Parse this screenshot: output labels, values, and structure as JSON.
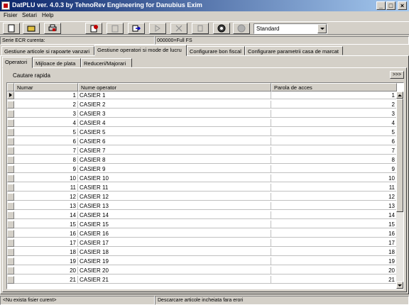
{
  "window": {
    "title": "DatPLU ver. 4.0.3 by TehnoRev Engineering for Danubius Exim",
    "minimize": "_",
    "maximize": "□",
    "close": "×"
  },
  "menu": [
    "Fisier",
    "Setari",
    "Help"
  ],
  "toolbar": {
    "buttons": [
      "new-file-icon",
      "open-folder-icon",
      "print-icon",
      "add-record-icon",
      "disabled-add-icon",
      "send-arrow-icon",
      "disabled-send-icon",
      "delete-icon",
      "disabled-icon",
      "disk-icon",
      "disabled-circle-icon"
    ],
    "profile_value": "Standard"
  },
  "status_top": {
    "serie_label": "Serie ECR curenta:",
    "serie_value": "000000=Full FS"
  },
  "tabs_main": [
    "Gestiune articole si rapoarte vanzari",
    "Gestiune operatori si mode de lucru",
    "Configurare bon fiscal",
    "Configurare parametrii casa de marcat"
  ],
  "tabs_sub": [
    "Operatori",
    "Mijloace de plata",
    "Reduceri/Majorari"
  ],
  "quick_search": {
    "label": "Cautare rapida",
    "button": ">>>"
  },
  "grid": {
    "columns": [
      "Numar",
      "Nume operator",
      "Parola de acces"
    ],
    "rows": [
      [
        "1",
        "CASIER  1",
        "1"
      ],
      [
        "2",
        "CASIER  2",
        "2"
      ],
      [
        "3",
        "CASIER  3",
        "3"
      ],
      [
        "4",
        "CASIER  4",
        "4"
      ],
      [
        "5",
        "CASIER  5",
        "5"
      ],
      [
        "6",
        "CASIER  6",
        "6"
      ],
      [
        "7",
        "CASIER  7",
        "7"
      ],
      [
        "8",
        "CASIER  8",
        "8"
      ],
      [
        "9",
        "CASIER  9",
        "9"
      ],
      [
        "10",
        "CASIER  10",
        "10"
      ],
      [
        "11",
        "CASIER  11",
        "11"
      ],
      [
        "12",
        "CASIER  12",
        "12"
      ],
      [
        "13",
        "CASIER  13",
        "13"
      ],
      [
        "14",
        "CASIER  14",
        "14"
      ],
      [
        "15",
        "CASIER  15",
        "15"
      ],
      [
        "16",
        "CASIER  16",
        "16"
      ],
      [
        "17",
        "CASIER  17",
        "17"
      ],
      [
        "18",
        "CASIER  18",
        "18"
      ],
      [
        "19",
        "CASIER  19",
        "19"
      ],
      [
        "20",
        "CASIER  20",
        "20"
      ],
      [
        "21",
        "CASIER  21",
        "21"
      ]
    ]
  },
  "statusbar": {
    "file": "<Nu exista fisier curent>",
    "message": "Descarcare articole incheiata fara erori"
  }
}
